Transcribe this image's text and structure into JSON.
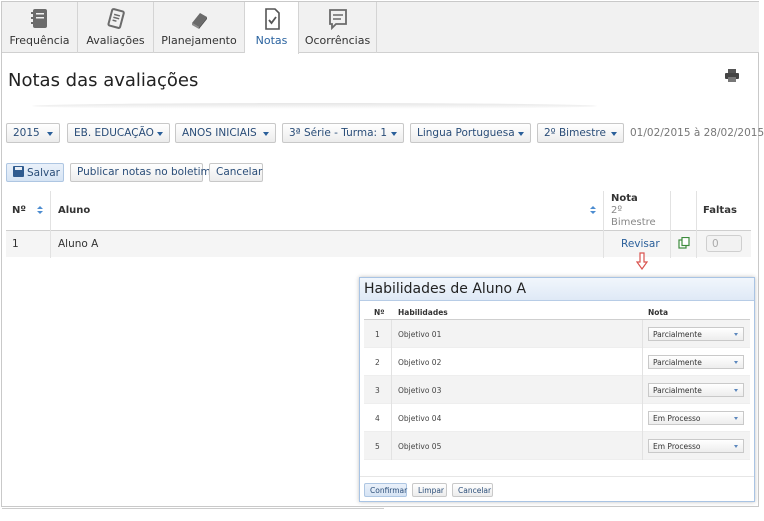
{
  "tabs": [
    {
      "label": "Frequência",
      "icon": "notebook-icon"
    },
    {
      "label": "Avaliações",
      "icon": "clipboard-icon"
    },
    {
      "label": "Planejamento",
      "icon": "books-icon"
    },
    {
      "label": "Notas",
      "icon": "document-check-icon",
      "active": true
    },
    {
      "label": "Ocorrências",
      "icon": "message-icon"
    }
  ],
  "page": {
    "title": "Notas das avaliações"
  },
  "filters": [
    "2015",
    "EB. EDUCAÇÃO",
    "ANOS INICIAIS",
    "3ª Série - Turma: 1",
    "Lingua Portuguesa",
    "2º Bimestre"
  ],
  "period": "01/02/2015 à 28/02/2015",
  "actions": {
    "save": "Salvar",
    "publish": "Publicar notas no boletim",
    "cancel": "Cancelar"
  },
  "table": {
    "headers": {
      "num": "Nº",
      "aluno": "Aluno",
      "nota": "Nota",
      "nota_sub1": "2º",
      "nota_sub2": "Bimestre",
      "faltas": "Faltas"
    },
    "rows": [
      {
        "num": "1",
        "aluno": "Aluno A",
        "nota_link": "Revisar",
        "faltas": "0"
      }
    ]
  },
  "modal": {
    "title": "Habilidades de Aluno A",
    "headers": {
      "num": "Nº",
      "hab": "Habilidades",
      "nota": "Nota"
    },
    "rows": [
      {
        "num": "1",
        "hab": "Objetivo 01",
        "nota": "Parcialmente"
      },
      {
        "num": "2",
        "hab": "Objetivo 02",
        "nota": "Parcialmente"
      },
      {
        "num": "3",
        "hab": "Objetivo 03",
        "nota": "Parcialmente"
      },
      {
        "num": "4",
        "hab": "Objetivo 04",
        "nota": "Em Processo"
      },
      {
        "num": "5",
        "hab": "Objetivo 05",
        "nota": "Em Processo"
      }
    ],
    "buttons": {
      "confirm": "Confirmar",
      "clear": "Limpar",
      "cancel": "Cancelar"
    }
  },
  "colors": {
    "accent": "#2a63a0",
    "link": "#2a5f9a",
    "arrow": "#d9534f"
  }
}
